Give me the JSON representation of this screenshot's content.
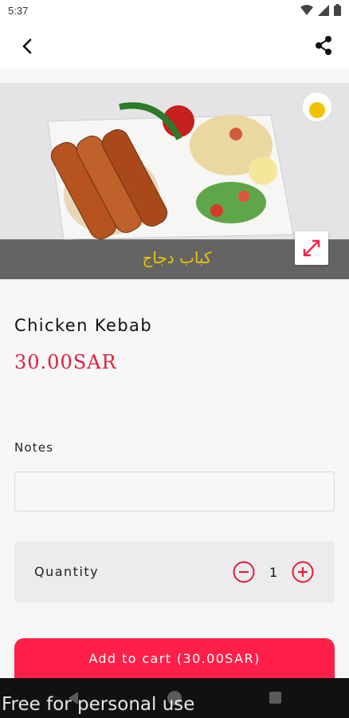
{
  "status_bar": {
    "time": "5:37"
  },
  "app_bar": {
    "back_icon": "chevron-left-icon",
    "share_icon": "share-icon"
  },
  "hero": {
    "caption_arabic": "كباب دجاج",
    "expand_icon": "expand-diagonal-icon"
  },
  "product": {
    "name": "Chicken Kebab",
    "price": "30.00SAR"
  },
  "notes": {
    "label": "Notes",
    "value": "",
    "placeholder": ""
  },
  "quantity": {
    "label": "Quantity",
    "value": "1",
    "minus_icon": "minus-circle-icon",
    "plus_icon": "plus-circle-icon"
  },
  "cart": {
    "add_label": "Add to cart (30.00SAR)"
  },
  "watermark": {
    "text": "Free for personal use"
  },
  "colors": {
    "accent": "#ff1f48",
    "price": "#e0203c",
    "background": "#f7f7f8",
    "card": "#ececee"
  }
}
